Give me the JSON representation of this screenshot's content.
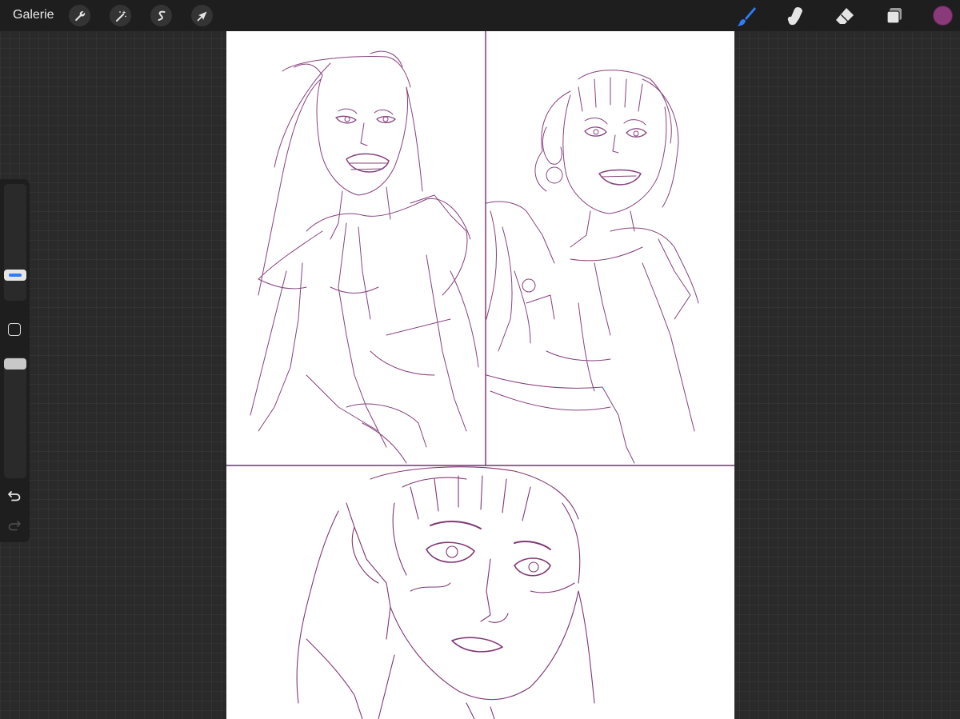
{
  "toolbar": {
    "gallery_label": "Galerie",
    "left_tools": [
      {
        "name": "actions",
        "icon": "wrench-icon"
      },
      {
        "name": "adjustments",
        "icon": "magic-wand-icon"
      },
      {
        "name": "selection",
        "icon": "selection-s-icon"
      },
      {
        "name": "transform",
        "icon": "arrow-cursor-icon"
      }
    ],
    "right_tools": [
      {
        "name": "brush",
        "icon": "brush-icon",
        "active": true
      },
      {
        "name": "smudge",
        "icon": "smudge-finger-icon",
        "active": false
      },
      {
        "name": "eraser",
        "icon": "eraser-icon",
        "active": false
      },
      {
        "name": "layers",
        "icon": "layers-icon",
        "active": false
      }
    ],
    "active_color": "#8a3a78",
    "accent_color": "#2f7df6"
  },
  "sidebar": {
    "brush_size_level": 0.27,
    "opacity_level": 1.0,
    "icons": [
      "modify-square-icon",
      "undo-icon",
      "redo-icon"
    ]
  },
  "canvas": {
    "background": "#ffffff",
    "stroke_color": "#7a2e6e",
    "panels": [
      "top-left-panel",
      "top-right-panel",
      "bottom-panel"
    ]
  }
}
